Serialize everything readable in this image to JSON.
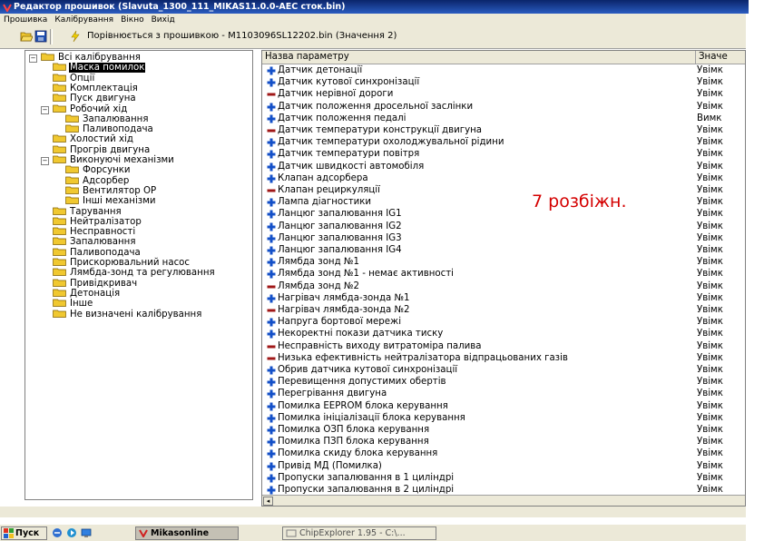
{
  "window": {
    "title": "Редактор прошивок (Slavuta_1300_111_MIKAS11.0.0-AEC сток.bin)"
  },
  "menu": [
    "Прошивка",
    "Калібрування",
    "Вікно",
    "Вихід"
  ],
  "toolbar": {
    "status": "Порівнюється з прошивкою - M1103096SL12202.bin (Значення 2)"
  },
  "tree": [
    {
      "label": "Всі калібрування",
      "level": 0,
      "exp": "-"
    },
    {
      "label": "Маска помилок",
      "level": 1,
      "selected": true
    },
    {
      "label": "Опції",
      "level": 1
    },
    {
      "label": "Комплектація",
      "level": 1
    },
    {
      "label": "Пуск двигуна",
      "level": 1
    },
    {
      "label": "Робочий хід",
      "level": 1,
      "exp": "-"
    },
    {
      "label": "Запалювання",
      "level": 2
    },
    {
      "label": "Паливоподача",
      "level": 2
    },
    {
      "label": "Холостий хід",
      "level": 1
    },
    {
      "label": "Прогрів двигуна",
      "level": 1
    },
    {
      "label": "Виконуючі механізми",
      "level": 1,
      "exp": "-"
    },
    {
      "label": "Форсунки",
      "level": 2
    },
    {
      "label": "Адсорбер",
      "level": 2
    },
    {
      "label": "Вентилятор ОР",
      "level": 2
    },
    {
      "label": "Інші механізми",
      "level": 2
    },
    {
      "label": "Тарування",
      "level": 1
    },
    {
      "label": "Нейтралізатор",
      "level": 1
    },
    {
      "label": "Несправності",
      "level": 1
    },
    {
      "label": "Запалювання",
      "level": 1
    },
    {
      "label": "Паливоподача",
      "level": 1
    },
    {
      "label": "Прискорювальний насос",
      "level": 1
    },
    {
      "label": "Лямбда-зонд та регулювання",
      "level": 1
    },
    {
      "label": "Привідкривач",
      "level": 1
    },
    {
      "label": "Детонація",
      "level": 1
    },
    {
      "label": "Інше",
      "level": 1
    },
    {
      "label": "Не визначені калібрування",
      "level": 1
    }
  ],
  "list": {
    "col_name": "Назва параметру",
    "col_value": "Значе",
    "rows": [
      {
        "name": "Датчик детонації",
        "sign": "plus",
        "value": "Увімк"
      },
      {
        "name": "Датчик кутової синхронізації",
        "sign": "plus",
        "value": "Увімк"
      },
      {
        "name": "Датчик нерівної дороги",
        "sign": "minus",
        "value": "Увімк"
      },
      {
        "name": "Датчик положення дросельної заслінки",
        "sign": "plus",
        "value": "Увімк"
      },
      {
        "name": "Датчик положення педалі",
        "sign": "plus",
        "value": "Вимк"
      },
      {
        "name": "Датчик температури конструкції двигуна",
        "sign": "minus",
        "value": "Увімк"
      },
      {
        "name": "Датчик температури охолоджувальної рідини",
        "sign": "plus",
        "value": "Увімк"
      },
      {
        "name": "Датчик температури повітря",
        "sign": "plus",
        "value": "Увімк"
      },
      {
        "name": "Датчик швидкості автомобіля",
        "sign": "plus",
        "value": "Увімк"
      },
      {
        "name": "Клапан адсорбера",
        "sign": "plus",
        "value": "Увімк"
      },
      {
        "name": "Клапан рециркуляції",
        "sign": "minus",
        "value": "Увімк"
      },
      {
        "name": "Лампа діагностики",
        "sign": "plus",
        "value": "Увімк"
      },
      {
        "name": "Ланцюг запалювання IG1",
        "sign": "plus",
        "value": "Увімк"
      },
      {
        "name": "Ланцюг запалювання IG2",
        "sign": "plus",
        "value": "Увімк"
      },
      {
        "name": "Ланцюг запалювання IG3",
        "sign": "plus",
        "value": "Увімк"
      },
      {
        "name": "Ланцюг запалювання IG4",
        "sign": "plus",
        "value": "Увімк"
      },
      {
        "name": "Лямбда зонд №1",
        "sign": "plus",
        "value": "Увімк"
      },
      {
        "name": "Лямбда зонд №1 - немає активності",
        "sign": "plus",
        "value": "Увімк"
      },
      {
        "name": "Лямбда зонд №2",
        "sign": "minus",
        "value": "Увімк"
      },
      {
        "name": "Нагрівач лямбда-зонда №1",
        "sign": "plus",
        "value": "Увімк"
      },
      {
        "name": "Нагрівач лямбда-зонда №2",
        "sign": "minus",
        "value": "Увімк"
      },
      {
        "name": "Напруга бортової мережі",
        "sign": "plus",
        "value": "Увімк"
      },
      {
        "name": "Некоректні покази датчика тиску",
        "sign": "plus",
        "value": "Увімк"
      },
      {
        "name": "Несправність виходу витратоміра палива",
        "sign": "minus",
        "value": "Увімк"
      },
      {
        "name": "Низька ефективність нейтралізатора відпрацьованих газів",
        "sign": "minus",
        "value": "Увімк"
      },
      {
        "name": "Обрив датчика кутової синхронізації",
        "sign": "plus",
        "value": "Увімк"
      },
      {
        "name": "Перевищення допустимих обертів",
        "sign": "plus",
        "value": "Увімк"
      },
      {
        "name": "Перегрівання двигуна",
        "sign": "plus",
        "value": "Увімк"
      },
      {
        "name": "Помилка EEPROM блока керування",
        "sign": "plus",
        "value": "Увімк"
      },
      {
        "name": "Помилка ініціалізації блока керування",
        "sign": "plus",
        "value": "Увімк"
      },
      {
        "name": "Помилка ОЗП блока керування",
        "sign": "plus",
        "value": "Увімк"
      },
      {
        "name": "Помилка ПЗП блока керування",
        "sign": "plus",
        "value": "Увімк"
      },
      {
        "name": "Помилка скиду блока керування",
        "sign": "plus",
        "value": "Увімк"
      },
      {
        "name": "Привід МД (Помилка)",
        "sign": "plus",
        "value": "Увімк"
      },
      {
        "name": "Пропуски запалювання в 1 циліндрі",
        "sign": "plus",
        "value": "Увімк"
      },
      {
        "name": "Пропуски запалювання в 2 циліндрі",
        "sign": "plus",
        "value": "Увімк"
      }
    ]
  },
  "annotation": "7  розбіжн.",
  "taskbar": {
    "start": "Пуск",
    "buttons": [
      "Mikasonline",
      "ChipExplorer  1.95 - C:\\..."
    ]
  },
  "colors": {
    "plus": "#1450c8",
    "minus": "#a01818",
    "folder": "#f0c830"
  }
}
